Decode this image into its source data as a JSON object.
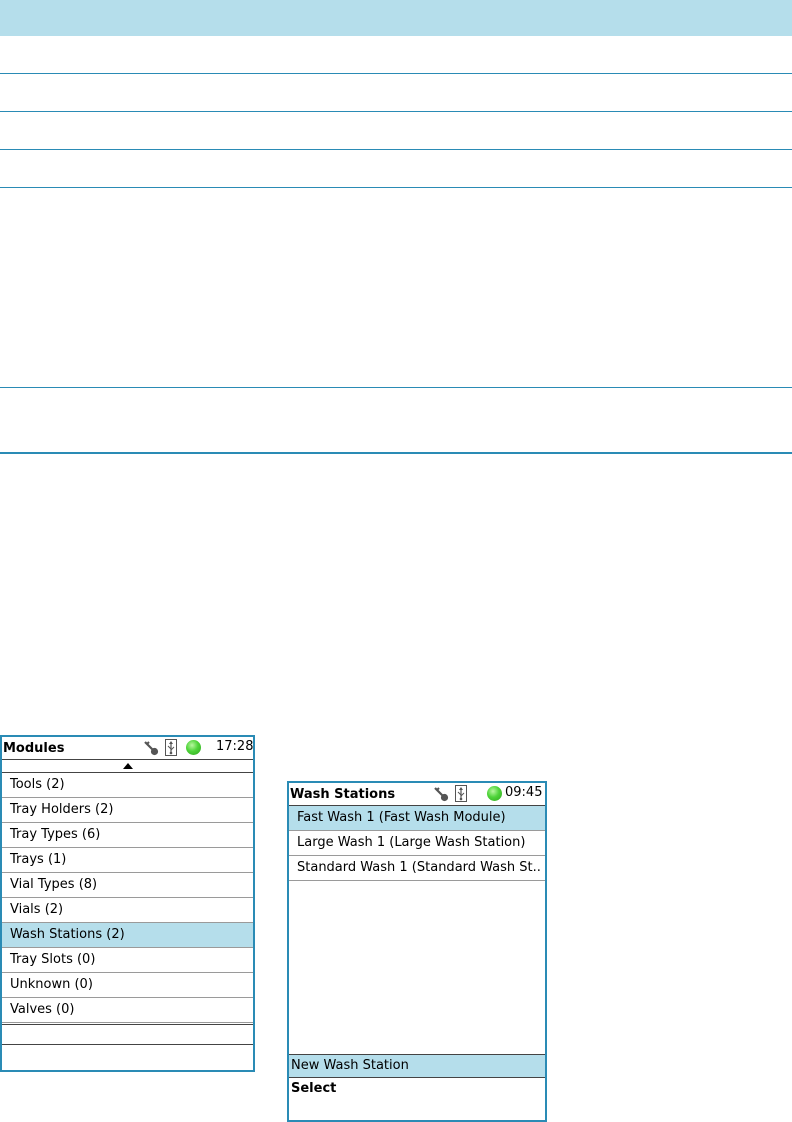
{
  "modules_screen": {
    "title": "Modules",
    "time": "17:28",
    "items": [
      "Tools (2)",
      "Tray Holders (2)",
      "Tray Types (6)",
      "Trays (1)",
      "Vial Types (8)",
      "Vials (2)",
      "Wash Stations (2)",
      "Tray Slots (0)",
      "Unknown (0)",
      "Valves (0)"
    ],
    "selected_item": "Wash Stations (2)"
  },
  "wash_screen": {
    "title": "Wash Stations",
    "time": "09:45",
    "items": [
      "Fast Wash 1 (Fast Wash Module)",
      "Large Wash 1 (Large Wash Station)",
      "Standard Wash 1 (Standard Wash St.."
    ],
    "selected_item": "Fast Wash 1 (Fast Wash Module)",
    "softkey_1": "New Wash Station",
    "softkey_2": "Select"
  },
  "icons": {
    "status": [
      "key-icon",
      "usb-icon",
      "status-led-icon"
    ],
    "scroll": "scroll-up-arrow-icon"
  },
  "colors": {
    "accent": "#2a8bb5",
    "selection": "#b5deeb",
    "led": "#4fd43a"
  }
}
